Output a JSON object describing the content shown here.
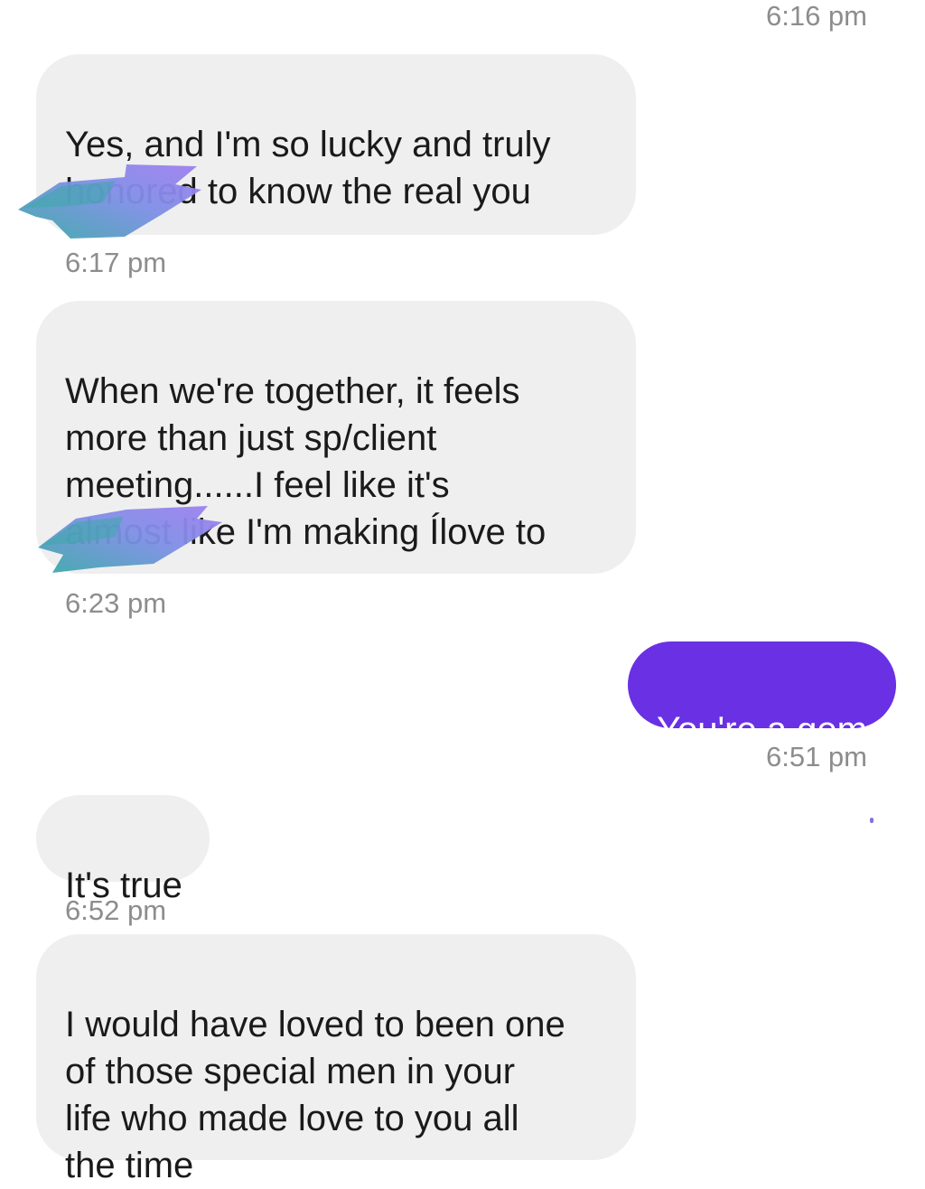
{
  "conversation": {
    "messages": [
      {
        "time": "6:16 pm",
        "direction": "incoming",
        "text": "Yes, and I'm so lucky and truly\nhonored to know the real you"
      },
      {
        "time": "6:17 pm",
        "direction": "incoming",
        "text": "When we're together,  it feels\nmore than just sp/client\nmeeting......I  feel like it's\nalmost like I'm making Ílove to"
      },
      {
        "time": "6:23 pm",
        "direction": "outgoing",
        "text": "You're a gem"
      },
      {
        "time": "6:51 pm",
        "direction": "incoming",
        "text": "It's true"
      },
      {
        "time": "6:52 pm",
        "direction": "incoming",
        "text": "I would have loved to been one\nof those special men in your\nlife who made love to you all\nthe time"
      }
    ]
  },
  "colors": {
    "incoming_bubble": "#efefef",
    "outgoing_bubble": "#6a30e3",
    "timestamp": "#8d8d8d",
    "redaction_teal": "#3aa9a8",
    "redaction_violet": "#a07ff0"
  }
}
